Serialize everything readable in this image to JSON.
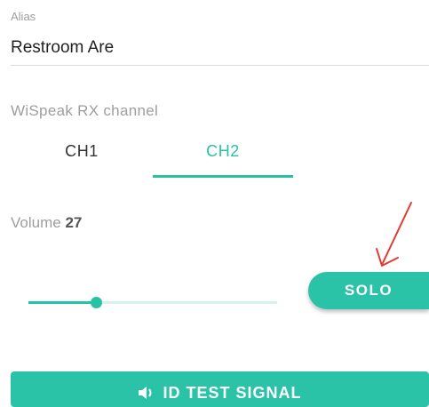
{
  "alias": {
    "label": "Alias",
    "value": "Restroom Are"
  },
  "rx_channel": {
    "label": "WiSpeak RX channel",
    "tabs": [
      {
        "label": "CH1",
        "selected": false
      },
      {
        "label": "CH2",
        "selected": true
      }
    ]
  },
  "volume": {
    "label": "Volume",
    "value": "27",
    "slider_level": 0.27
  },
  "solo_button": {
    "label": "SOLO"
  },
  "test_signal_button": {
    "label": "ID TEST SIGNAL",
    "icon": "speaker-icon"
  },
  "colors": {
    "accent": "#29c1a6",
    "annotation": "#e53935"
  }
}
